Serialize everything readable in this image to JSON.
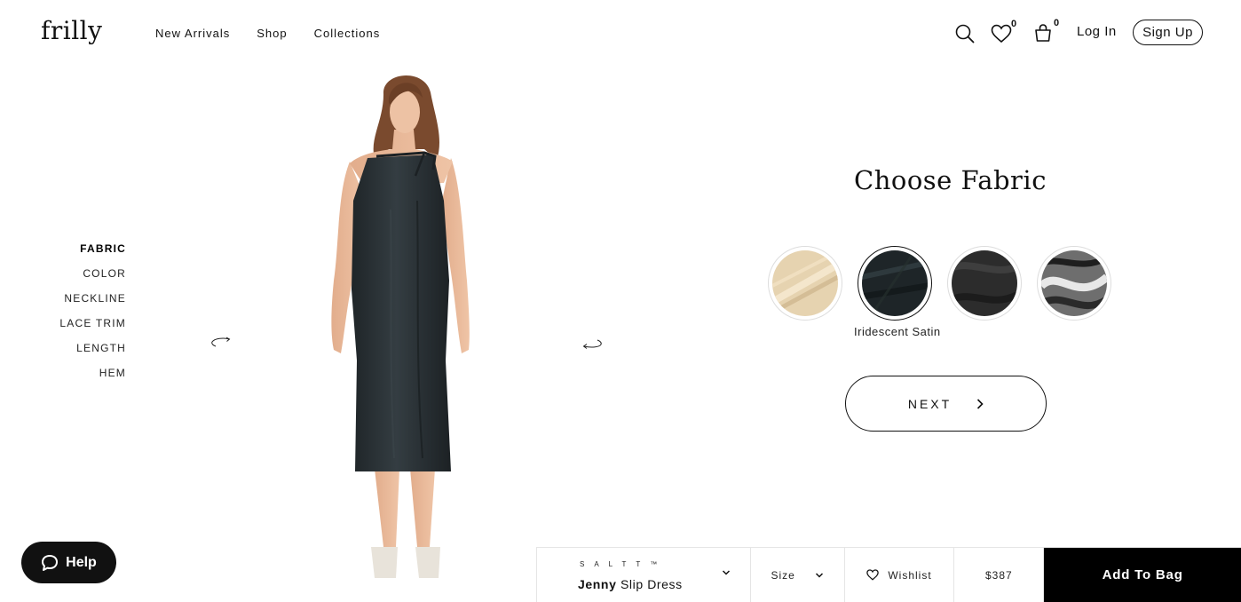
{
  "header": {
    "logo": "frilly",
    "nav": [
      "New Arrivals",
      "Shop",
      "Collections"
    ],
    "wishlist_count": "0",
    "cart_count": "0",
    "login": "Log In",
    "signup": "Sign Up"
  },
  "steps": [
    "FABRIC",
    "COLOR",
    "NECKLINE",
    "LACE TRIM",
    "LENGTH",
    "HEM"
  ],
  "chooser": {
    "title": "Choose Fabric",
    "swatches": [
      {
        "name": "beige-satin",
        "color": "#e6d3b0"
      },
      {
        "name": "iridescent-satin",
        "color": "#1e2528"
      },
      {
        "name": "charcoal-silk",
        "color": "#2c2c2c"
      },
      {
        "name": "metallic-silver",
        "color": "#6e6e6e"
      }
    ],
    "selected_label": "Iridescent Satin",
    "next": "NEXT"
  },
  "help": "Help",
  "bottom_bar": {
    "brand": "SALTT™",
    "product_bold": "Jenny",
    "product_rest": "Slip Dress",
    "size": "Size",
    "wishlist": "Wishlist",
    "price": "$387",
    "add_to_bag": "Add To Bag"
  },
  "colors": {
    "dress": "#2b3236",
    "skin": "#e8b898",
    "hair": "#7a4a2e",
    "black": "#000000"
  }
}
